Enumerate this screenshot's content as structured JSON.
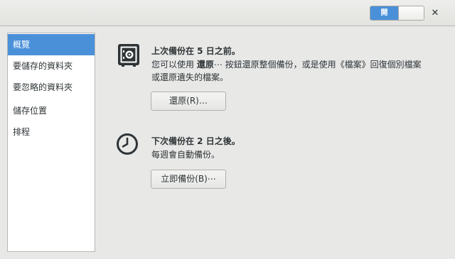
{
  "header": {
    "switch_label": "開",
    "close_glyph": "✕"
  },
  "sidebar": {
    "items": [
      {
        "label": "概覽"
      },
      {
        "label": "要儲存的資料夾"
      },
      {
        "label": "要忽略的資料夾"
      },
      {
        "label": "儲存位置"
      },
      {
        "label": "排程"
      }
    ]
  },
  "overview": {
    "last_backup": {
      "title": "上次備份在 5 日之前。",
      "desc_line1_prefix": "您可以使用 ",
      "desc_line1_bold": "還原",
      "desc_line1_suffix": "⋯ 按鈕還原整個備份，或是使用《檔案》回復個別檔案",
      "desc_line2": "或還原遺失的檔案。",
      "button_label": "還原(R)…"
    },
    "next_backup": {
      "title": "下次備份在 2 日之後。",
      "desc": "每週會自動備份。",
      "button_label": "立即備份(B)⋯"
    }
  },
  "colors": {
    "accent": "#4a90d9",
    "window_bg": "#e8e8e7",
    "text": "#2e3436"
  },
  "icons": {
    "safe": "safe-icon",
    "clock": "clock-icon",
    "close": "close-icon"
  }
}
